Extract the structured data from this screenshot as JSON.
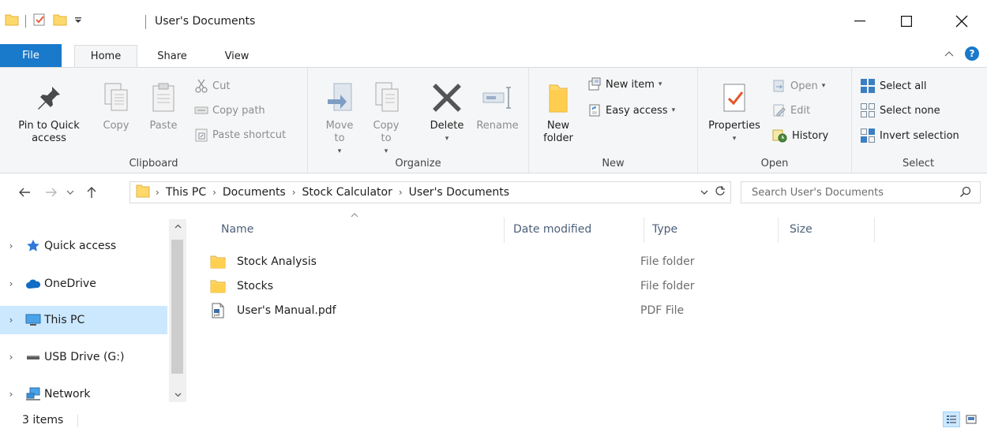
{
  "window": {
    "title": "User's Documents",
    "minimize_glyph": "—",
    "maximize_glyph": "☐",
    "close_glyph": "✕"
  },
  "tabs": {
    "file": "File",
    "home": "Home",
    "share": "Share",
    "view": "View",
    "collapse_glyph": "^",
    "help_glyph": "?"
  },
  "ribbon": {
    "clipboard": {
      "label": "Clipboard",
      "pin": "Pin to Quick access",
      "copy": "Copy",
      "paste": "Paste",
      "cut": "Cut",
      "copy_path": "Copy path",
      "paste_shortcut": "Paste shortcut"
    },
    "organize": {
      "label": "Organize",
      "move_to": "Move to",
      "copy_to": "Copy to",
      "delete": "Delete",
      "rename": "Rename"
    },
    "new": {
      "label": "New",
      "new_folder": "New folder",
      "new_item": "New item",
      "easy_access": "Easy access"
    },
    "open": {
      "label": "Open",
      "properties": "Properties",
      "open": "Open",
      "edit": "Edit",
      "history": "History"
    },
    "select": {
      "label": "Select",
      "select_all": "Select all",
      "select_none": "Select none",
      "invert_selection": "Invert selection"
    }
  },
  "address": {
    "crumbs": [
      "This PC",
      "Documents",
      "Stock Calculator",
      "User's Documents"
    ],
    "search_placeholder": "Search User's Documents"
  },
  "nav": {
    "items": [
      {
        "label": "Quick access"
      },
      {
        "label": "OneDrive"
      },
      {
        "label": "This PC"
      },
      {
        "label": "USB Drive (G:)"
      },
      {
        "label": "Network"
      }
    ]
  },
  "columns": {
    "name": "Name",
    "date": "Date modified",
    "type": "Type",
    "size": "Size"
  },
  "files": [
    {
      "name": "Stock Analysis",
      "type": "File folder",
      "icon": "folder-icon"
    },
    {
      "name": "Stocks",
      "type": "File folder",
      "icon": "folder-icon"
    },
    {
      "name": "User's Manual.pdf",
      "type": "PDF File",
      "icon": "pdf-file-icon"
    }
  ],
  "status": {
    "count": "3 items"
  },
  "colors": {
    "accent": "#1979ca",
    "folder": "#ffd86b",
    "selection": "#cce8ff"
  }
}
